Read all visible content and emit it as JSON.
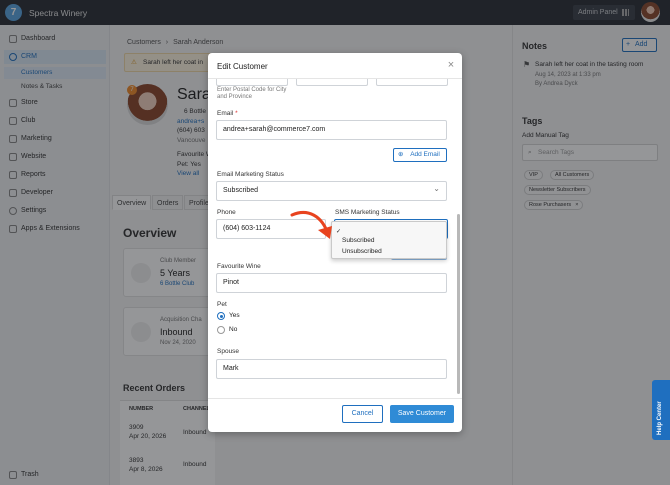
{
  "topbar": {
    "logo_glyph": "7",
    "brand": "Spectra Winery",
    "admin_panel": "Admin Panel"
  },
  "sidebar": {
    "items": [
      {
        "label": "Dashboard",
        "icon": "dashboard-icon"
      },
      {
        "label": "CRM",
        "icon": "crm-icon",
        "active": true
      },
      {
        "label": "Store",
        "icon": "store-icon"
      },
      {
        "label": "Club",
        "icon": "club-icon"
      },
      {
        "label": "Marketing",
        "icon": "marketing-icon"
      },
      {
        "label": "Website",
        "icon": "website-icon"
      },
      {
        "label": "Reports",
        "icon": "reports-icon"
      },
      {
        "label": "Developer",
        "icon": "developer-icon"
      },
      {
        "label": "Settings",
        "icon": "settings-icon"
      },
      {
        "label": "Apps & Extensions",
        "icon": "apps-icon"
      }
    ],
    "sub_items": [
      {
        "label": "Customers",
        "active": true
      },
      {
        "label": "Notes & Tasks"
      }
    ],
    "trash": "Trash"
  },
  "page": {
    "breadcrumb_root": "Customers",
    "breadcrumb_sep": "›",
    "breadcrumb_current": "Sarah Anderson",
    "alert": "Sarah left her coat in",
    "profile_badge": "7",
    "profile_name": "Sara",
    "profile_lines": [
      "6 Bottle",
      "andrea+s",
      "(604) 603",
      "Vancouve",
      "Favourite W",
      "Pet: Yes",
      "View all"
    ],
    "tabs": [
      "Overview",
      "Orders",
      "Profile"
    ],
    "overview_title": "Overview",
    "club_card": {
      "label": "Club Member",
      "value": "5 Years",
      "sub": "6 Bottle Club"
    },
    "acq_card": {
      "label": "Acquisition Cha",
      "value": "Inbound",
      "sub": "Nov 24, 2020"
    },
    "recent_orders_title": "Recent Orders",
    "order_headers": [
      "NUMBER",
      "CHANNEL"
    ],
    "orders": [
      {
        "number": "3909",
        "date": "Apr 20, 2026",
        "channel": "Inbound"
      },
      {
        "number": "3893",
        "date": "Apr 8, 2026",
        "channel": "Inbound"
      }
    ]
  },
  "right_panel": {
    "notes_title": "Notes",
    "add_label": "Add",
    "note": {
      "text": "Sarah left her coat in the tasting room",
      "date": "Aug 14, 2023 at 1:33 pm",
      "author": "By Andrea Dyck"
    },
    "tags_title": "Tags",
    "add_manual_tag": "Add Manual Tag",
    "tag_search_placeholder": "Search Tags",
    "tags": [
      "VIP",
      "All Customers",
      "Newsletter Subscribers",
      "Rose Purchasers"
    ]
  },
  "modal": {
    "title": "Edit Customer",
    "postal_help": "Enter Postal Code for City and Province",
    "email_label": "Email",
    "email_required": "*",
    "email_value": "andrea+sarah@commerce7.com",
    "add_email": "Add Email",
    "email_marketing_label": "Email Marketing Status",
    "email_marketing_value": "Subscribed",
    "phone_label": "Phone",
    "phone_value": "(604) 603-1124",
    "sms_label": "SMS Marketing Status",
    "sms_options": [
      "",
      "Subscribed",
      "Unsubscribed"
    ],
    "sms_selected_check": "✓",
    "favourite_wine_label": "Favourite Wine",
    "favourite_wine_value": "Pinot",
    "pet_label": "Pet",
    "pet_options": [
      "Yes",
      "No"
    ],
    "spouse_label": "Spouse",
    "spouse_value": "Mark",
    "cancel": "Cancel",
    "save": "Save Customer"
  },
  "help_center": "Help Center",
  "colors": {
    "accent": "#1f6fbf",
    "save": "#2f8bd6",
    "arrow": "#e8431f",
    "topbar": "#2b2f36"
  }
}
